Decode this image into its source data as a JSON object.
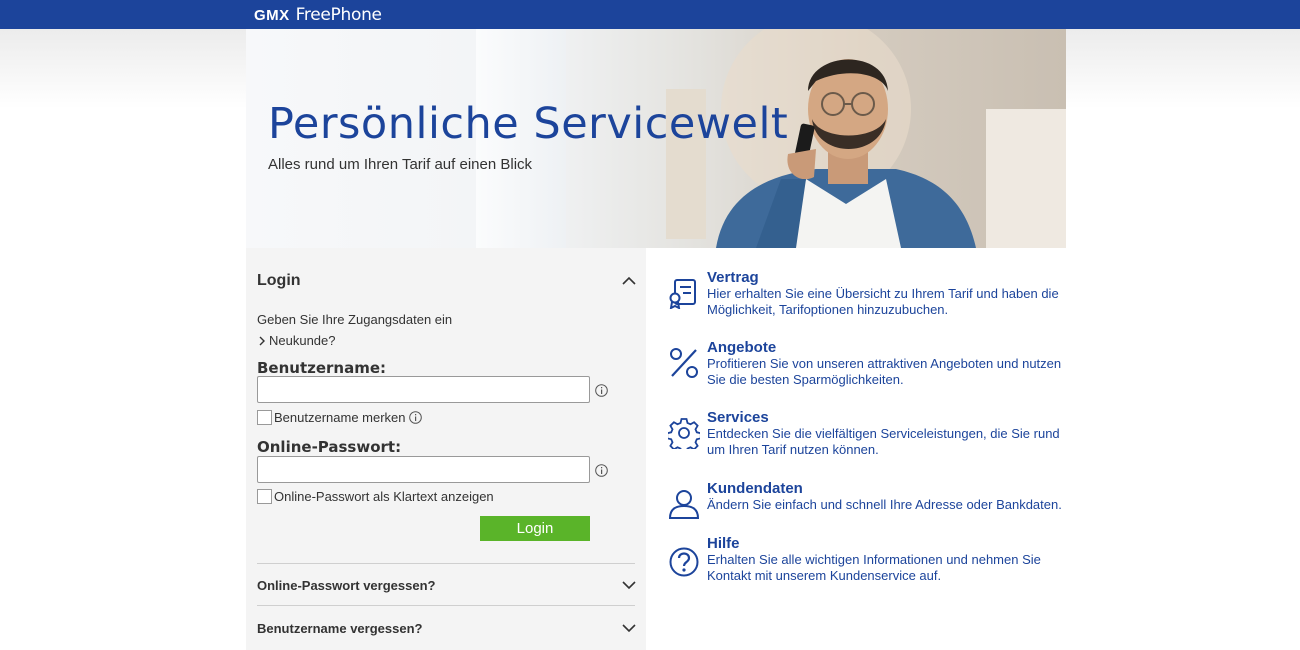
{
  "header": {
    "brand_name": "GMX",
    "product_name": "FreePhone",
    "brand_color": "#1c449b"
  },
  "hero": {
    "title": "Persönliche Servicewelt",
    "subtitle": "Alles rund um Ihren Tarif auf einen Blick"
  },
  "login": {
    "heading": "Login",
    "intro": "Geben Sie Ihre Zugangsdaten ein",
    "new_customer_link": "Neukunde?",
    "username_label": "Benutzername:",
    "username_value": "",
    "remember_username_label": "Benutzername merken",
    "remember_username_checked": false,
    "password_label": "Online-Passwort:",
    "password_value": "",
    "show_password_label": "Online-Passwort als Klartext anzeigen",
    "show_password_checked": false,
    "submit_label": "Login",
    "submit_color": "#5ab429",
    "forgot_password": "Online-Passwort vergessen?",
    "forgot_username": "Benutzername vergessen?"
  },
  "features": [
    {
      "title": "Vertrag",
      "description": "Hier erhalten Sie eine Übersicht zu Ihrem Tarif und haben die Möglichkeit, Tarifoptionen hinzuzubuchen.",
      "icon": "contract-icon"
    },
    {
      "title": "Angebote",
      "description": "Profitieren Sie von unseren attraktiven Angeboten und nutzen Sie die besten Sparmöglichkeiten.",
      "icon": "percent-icon"
    },
    {
      "title": "Services",
      "description": "Entdecken Sie die vielfältigen Serviceleistungen, die Sie rund um Ihren Tarif nutzen können.",
      "icon": "gear-icon"
    },
    {
      "title": "Kundendaten",
      "description": "Ändern Sie einfach und schnell Ihre Adresse oder Bankdaten.",
      "icon": "user-icon"
    },
    {
      "title": "Hilfe",
      "description": "Erhalten Sie alle wichtigen Informationen und nehmen Sie Kontakt mit unserem Kundenservice auf.",
      "icon": "help-icon"
    }
  ]
}
